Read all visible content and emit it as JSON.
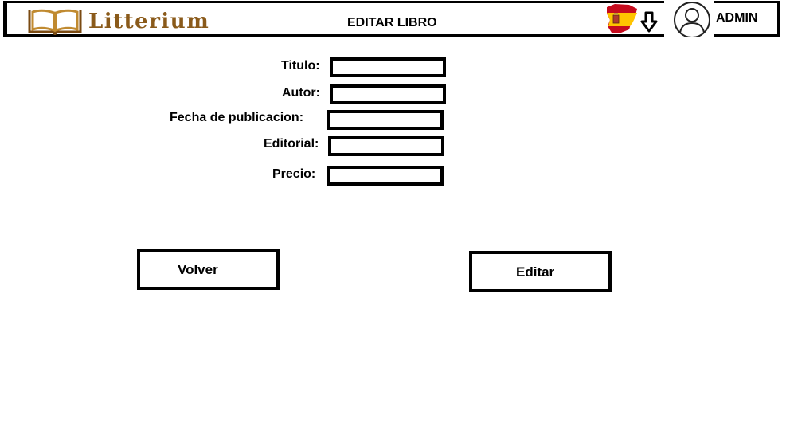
{
  "header": {
    "brand": "Litterium",
    "page_title": "EDITAR LIBRO",
    "user_label": "ADMIN",
    "flag_icon": "spain-flag-icon",
    "menu_icon": "down-arrow-icon",
    "avatar_icon": "user-avatar-icon"
  },
  "form": {
    "titulo_label": "Titulo:",
    "autor_label": "Autor:",
    "fecha_label": "Fecha de publicacion:",
    "editorial_label": "Editorial:",
    "precio_label": "Precio:",
    "titulo_value": "",
    "autor_value": "",
    "fecha_value": "",
    "editorial_value": "",
    "precio_value": ""
  },
  "actions": {
    "back_label": "Volver",
    "edit_label": "Editar"
  },
  "colors": {
    "brand": "#8a5a1a",
    "flag_red": "#c60b1e",
    "flag_yellow": "#ffc400",
    "border": "#000000"
  }
}
